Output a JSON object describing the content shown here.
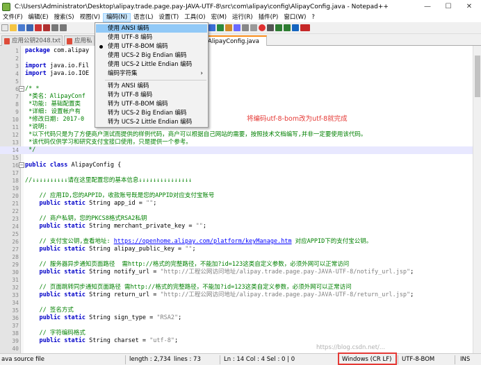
{
  "window": {
    "title": "C:\\Users\\Administrator\\Desktop\\alipay.trade.page.pay-JAVA-UTF-8\\src\\com\\alipay\\config\\AlipayConfig.java - Notepad++",
    "minimize": "—",
    "maximize": "☐",
    "close": "✕"
  },
  "menu": [
    "文件(F)",
    "编辑(E)",
    "搜索(S)",
    "视图(V)",
    "编码(N)",
    "语言(L)",
    "设置(T)",
    "工具(O)",
    "宏(M)",
    "运行(R)",
    "插件(P)",
    "窗口(W)",
    "?"
  ],
  "tabs": [
    "应用公钥2048.txt",
    "应用私",
    "AlipayConfig.java"
  ],
  "dropdown": {
    "items": [
      "使用 ANSI 编码",
      "使用 UTF-8 编码",
      "使用 UTF-8-BOM 编码",
      "使用 UCS-2 Big Endian 编码",
      "使用 UCS-2 Little Endian 编码",
      "编码字符集"
    ],
    "convert_items": [
      "转为 ANSI 编码",
      "转为 UTF-8 编码",
      "转为 UTF-8-BOM 编码",
      "转为 UCS-2 Big Endian 编码",
      "转为 UCS-2 Little Endian 编码"
    ],
    "submenu_arrow": "›",
    "highlighted_index": 0,
    "checked_index": 2
  },
  "code": {
    "line1_kw": "package",
    "line1_rest": " com.alipay",
    "line3_kw": "import",
    "line3_rest": " java.io.Fil",
    "line4_kw": "import",
    "line4_rest": " java.io.IOE",
    "line6": "/* *",
    "line7": " *类名：AlipayConf",
    "line8": " *功能: 基础配置类",
    "line9": " *详细: 设置帐户有",
    "line10": " *修改日期: 2017-0",
    "line11": " *说明:",
    "line12": " *以下代码只是为了方便商户测试而提供的样例代码，商户可以根据自己网站的需要，按照技术文档编写,并非一定要使用该代码。",
    "line13": " *该代码仅供学习和研究支付宝接口使用，只是提供一个参考。",
    "line14": " */",
    "line16_kw": "public class",
    "line16_rest": " AlipayConfig {",
    "line18": "//↓↓↓↓↓↓↓↓↓↓请在这里配置您的基本信息↓↓↓↓↓↓↓↓↓↓↓↓↓↓↓",
    "line20": "    // 应用ID,您的APPID，收款账号既是您的APPID对应支付宝账号",
    "line21_kw": "    public static",
    "line21_mid": " String app_id = ",
    "line21_str": "\"\"",
    "line21_end": ";",
    "line23": "    // 商户私钥，您的PKCS8格式RSA2私钥",
    "line24_kw": "    public static",
    "line24_mid": " String merchant_private_key = ",
    "line24_str": "\"\"",
    "line24_end": ";",
    "line26_a": "    // 支付宝公钥,查看地址: ",
    "line26_url": "https://openhome.alipay.com/platform/keyManage.htm",
    "line26_b": " 对应APPID下的支付宝公钥。",
    "line27_kw": "    public static",
    "line27_mid": " String alipay_public_key = ",
    "line27_str": "\"\"",
    "line27_end": ";",
    "line29": "    // 服务器异步通知页面路径  需http://格式的完整路径，不能加?id=123这类自定义参数，必须外网可以正常访问",
    "line30_kw": "    public static",
    "line30_mid": " String notify_url = ",
    "line30_str": "\"http://工程公网访问地址/alipay.trade.page.pay-JAVA-UTF-8/notify_url.jsp\"",
    "line30_end": ";",
    "line32": "    // 页面跳转同步通知页面路径 需http://格式的完整路径，不能加?id=123这类自定义参数，必须外网可以正常访问",
    "line33_kw": "    public static",
    "line33_mid": " String return_url = ",
    "line33_str": "\"http://工程公网访问地址/alipay.trade.page.pay-JAVA-UTF-8/return_url.jsp\"",
    "line33_end": ";",
    "line35": "    // 签名方式",
    "line36_kw": "    public static",
    "line36_mid": " String sign_type = ",
    "line36_str": "\"RSA2\"",
    "line36_end": ";",
    "line38": "    // 字符编码格式",
    "line39_kw": "    public static",
    "line39_mid": " String charset = ",
    "line39_str": "\"utf-8\"",
    "line39_end": ";"
  },
  "annotation": "将编码utf-8-bom改为utf-8就完成",
  "status": {
    "filetype": "ava source file",
    "length": "length : 2,734",
    "lines": "lines : 73",
    "pos": "Ln : 14    Col : 4    Sel : 0 | 0",
    "eol": "Windows (CR LF)",
    "encoding": "UTF-8-BOM",
    "mode": "INS"
  },
  "watermark": "https://blog.csdn.net/..."
}
